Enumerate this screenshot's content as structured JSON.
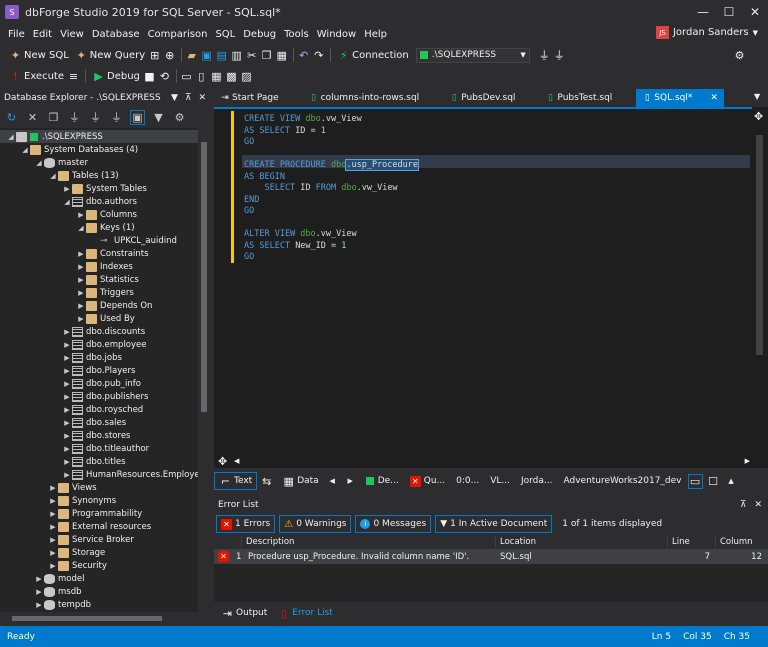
{
  "window": {
    "title": "dbForge Studio 2019 for SQL Server - SQL.sql*",
    "app_icon": "S",
    "minimize": "—",
    "maximize": "☐",
    "close": "✕"
  },
  "menu": [
    "File",
    "Edit",
    "View",
    "Database",
    "Comparison",
    "SQL",
    "Debug",
    "Tools",
    "Window",
    "Help"
  ],
  "user": {
    "initials": "JS",
    "name": "Jordan Sanders"
  },
  "toolbar1": {
    "new_sql": "New SQL",
    "new_query": "New Query",
    "connection_label": "Connection",
    "connection_value": ".\\SQLEXPRESS"
  },
  "toolbar2": {
    "execute": "Execute",
    "debug": "Debug"
  },
  "explorer": {
    "title": "Database Explorer - .\\SQLEXPRESS",
    "items": [
      {
        "label": ".\\SQLEXPRESS",
        "level": 0,
        "icon": "server",
        "expanded": true,
        "selected": true
      },
      {
        "label": "System Databases (4)",
        "level": 1,
        "icon": "folder",
        "expanded": true
      },
      {
        "label": "master",
        "level": 2,
        "icon": "db",
        "expanded": true
      },
      {
        "label": "Tables (13)",
        "level": 3,
        "icon": "folder",
        "expanded": true
      },
      {
        "label": "System Tables",
        "level": 4,
        "icon": "folder",
        "expanded": false
      },
      {
        "label": "dbo.authors",
        "level": 4,
        "icon": "table",
        "expanded": true
      },
      {
        "label": "Columns",
        "level": 5,
        "icon": "folder",
        "expanded": false
      },
      {
        "label": "Keys (1)",
        "level": 5,
        "icon": "folder",
        "expanded": true
      },
      {
        "label": "UPKCL_auidind",
        "level": 6,
        "icon": "key",
        "expanded": false
      },
      {
        "label": "Constraints",
        "level": 5,
        "icon": "folder",
        "expanded": false
      },
      {
        "label": "Indexes",
        "level": 5,
        "icon": "folder",
        "expanded": false
      },
      {
        "label": "Statistics",
        "level": 5,
        "icon": "folder",
        "expanded": false
      },
      {
        "label": "Triggers",
        "level": 5,
        "icon": "folder",
        "expanded": false
      },
      {
        "label": "Depends On",
        "level": 5,
        "icon": "folder",
        "expanded": false
      },
      {
        "label": "Used By",
        "level": 5,
        "icon": "folder",
        "expanded": false
      },
      {
        "label": "dbo.discounts",
        "level": 4,
        "icon": "table",
        "expanded": false
      },
      {
        "label": "dbo.employee",
        "level": 4,
        "icon": "table",
        "expanded": false
      },
      {
        "label": "dbo.jobs",
        "level": 4,
        "icon": "table",
        "expanded": false
      },
      {
        "label": "dbo.Players",
        "level": 4,
        "icon": "table",
        "expanded": false
      },
      {
        "label": "dbo.pub_info",
        "level": 4,
        "icon": "table",
        "expanded": false
      },
      {
        "label": "dbo.publishers",
        "level": 4,
        "icon": "table",
        "expanded": false
      },
      {
        "label": "dbo.roysched",
        "level": 4,
        "icon": "table",
        "expanded": false
      },
      {
        "label": "dbo.sales",
        "level": 4,
        "icon": "table",
        "expanded": false
      },
      {
        "label": "dbo.stores",
        "level": 4,
        "icon": "table",
        "expanded": false
      },
      {
        "label": "dbo.titleauthor",
        "level": 4,
        "icon": "table",
        "expanded": false
      },
      {
        "label": "dbo.titles",
        "level": 4,
        "icon": "table",
        "expanded": false
      },
      {
        "label": "HumanResources.Employee",
        "level": 4,
        "icon": "table",
        "expanded": false
      },
      {
        "label": "Views",
        "level": 3,
        "icon": "folder",
        "expanded": false
      },
      {
        "label": "Synonyms",
        "level": 3,
        "icon": "folder",
        "expanded": false
      },
      {
        "label": "Programmability",
        "level": 3,
        "icon": "folder",
        "expanded": false
      },
      {
        "label": "External resources",
        "level": 3,
        "icon": "folder",
        "expanded": false
      },
      {
        "label": "Service Broker",
        "level": 3,
        "icon": "folder",
        "expanded": false
      },
      {
        "label": "Storage",
        "level": 3,
        "icon": "folder",
        "expanded": false
      },
      {
        "label": "Security",
        "level": 3,
        "icon": "folder",
        "expanded": false
      },
      {
        "label": "model",
        "level": 2,
        "icon": "db",
        "expanded": false
      },
      {
        "label": "msdb",
        "level": 2,
        "icon": "db",
        "expanded": false
      },
      {
        "label": "tempdb",
        "level": 2,
        "icon": "db",
        "expanded": false
      }
    ]
  },
  "tabs": [
    {
      "label": "Start Page",
      "active": false
    },
    {
      "label": "columns-into-rows.sql",
      "active": false
    },
    {
      "label": "PubsDev.sql",
      "active": false
    },
    {
      "label": "PubsTest.sql",
      "active": false
    },
    {
      "label": "SQL.sql*",
      "active": true
    }
  ],
  "code": [
    [
      {
        "t": "CREATE VIEW ",
        "c": "kw"
      },
      {
        "t": "dbo",
        "c": "sch"
      },
      {
        "t": ".vw_View",
        "c": ""
      }
    ],
    [
      {
        "t": "AS SELECT ",
        "c": "kw"
      },
      {
        "t": "ID = ",
        "c": ""
      },
      {
        "t": "1",
        "c": "num"
      }
    ],
    [
      {
        "t": "GO",
        "c": "kw"
      }
    ],
    [],
    [
      {
        "t": "CREATE PROCEDURE ",
        "c": "kw"
      },
      {
        "t": "dbo",
        "c": "sch"
      },
      {
        "t": ".usp_Procedure",
        "c": "sel"
      }
    ],
    [
      {
        "t": "AS BEGIN",
        "c": "kw"
      }
    ],
    [
      {
        "t": "    SELECT ",
        "c": "kw"
      },
      {
        "t": "ID ",
        "c": ""
      },
      {
        "t": "FROM ",
        "c": "kw"
      },
      {
        "t": "dbo",
        "c": "sch"
      },
      {
        "t": ".vw_View",
        "c": ""
      }
    ],
    [
      {
        "t": "END",
        "c": "kw"
      }
    ],
    [
      {
        "t": "GO",
        "c": "kw"
      }
    ],
    [],
    [
      {
        "t": "ALTER VIEW ",
        "c": "kw"
      },
      {
        "t": "dbo",
        "c": "sch"
      },
      {
        "t": ".vw_View",
        "c": ""
      }
    ],
    [
      {
        "t": "AS SELECT ",
        "c": "kw"
      },
      {
        "t": "New_ID = ",
        "c": ""
      },
      {
        "t": "1",
        "c": "num"
      }
    ],
    [
      {
        "t": "GO",
        "c": "kw"
      }
    ]
  ],
  "result_bar": {
    "text": "Text",
    "data": "Data",
    "de": "De...",
    "qu": "Qu...",
    "time": "0:0...",
    "vl": "VL...",
    "user": "Jorda...",
    "db": "AdventureWorks2017_dev"
  },
  "error_list": {
    "title": "Error List",
    "errors_btn": "1 Errors",
    "warnings_btn": "0 Warnings",
    "messages_btn": "0 Messages",
    "active_doc_btn": "1 In Active Document",
    "count_text": "1 of 1 items displayed",
    "columns": [
      "Description",
      "Location",
      "Line",
      "Column"
    ],
    "rows": [
      {
        "num": "1",
        "description": "Procedure usp_Procedure. Invalid column name 'ID'.",
        "location": "SQL.sql",
        "line": "7",
        "column": "12"
      }
    ]
  },
  "bottom_tabs": {
    "output": "Output",
    "error_list": "Error List"
  },
  "status": {
    "text": "Ready",
    "ln": "Ln 5",
    "col": "Col 35",
    "ch": "Ch 35"
  },
  "colors": {
    "accent": "#007acc",
    "bg": "#2d2d30",
    "editor_bg": "#1e1e1e",
    "keyword": "#569cd6",
    "schema": "#57a64a",
    "error": "#e51400"
  }
}
